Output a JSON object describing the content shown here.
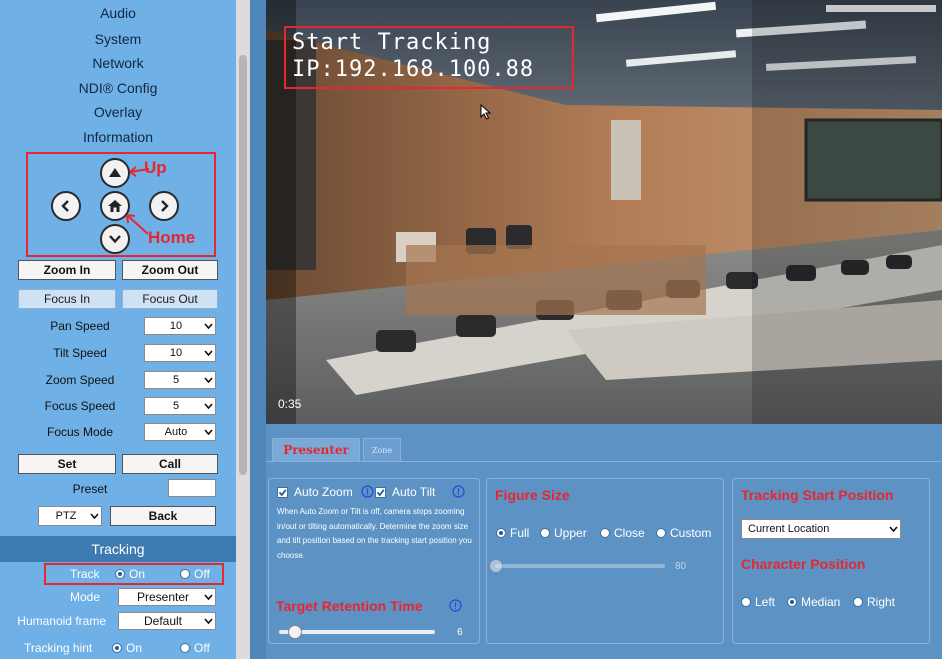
{
  "sidebar": {
    "nav": [
      "Audio",
      "System",
      "Network",
      "NDI® Config",
      "Overlay",
      "Information"
    ],
    "ptz_annotations": {
      "up": "Up",
      "home": "Home"
    },
    "zoom_in": "Zoom In",
    "zoom_out": "Zoom Out",
    "focus_in": "Focus In",
    "focus_out": "Focus Out",
    "speeds": [
      {
        "label": "Pan Speed",
        "value": "10"
      },
      {
        "label": "Tilt Speed",
        "value": "10"
      },
      {
        "label": "Zoom Speed",
        "value": "5"
      },
      {
        "label": "Focus Speed",
        "value": "5"
      },
      {
        "label": "Focus Mode",
        "value": "Auto"
      }
    ],
    "set": "Set",
    "call": "Call",
    "preset_label": "Preset",
    "preset_value": "",
    "mode_select": "PTZ",
    "back": "Back",
    "tracking_title": "Tracking",
    "track_label": "Track",
    "track_on": "On",
    "track_off": "Off",
    "mode_label": "Mode",
    "mode_value": "Presenter",
    "humanoid_label": "Humanoid frame",
    "humanoid_value": "Default",
    "hint_label": "Tracking hint",
    "hint_on": "On",
    "hint_off": "Off"
  },
  "video": {
    "osd_line1": "Start Tracking",
    "osd_line2": "IP:192.168.100.88",
    "timecode": "0:35"
  },
  "tabs": {
    "presenter": "Presenter",
    "zone": "Zone"
  },
  "panel": {
    "auto_zoom": "Auto Zoom",
    "auto_tilt": "Auto Tilt",
    "description": "When Auto Zoom or Tilt is off, camera stops zooming in/out or tilting automatically. Determine the zoom size and tilt position based on the tracking start position you choose.",
    "retention_title": "Target Retention Time",
    "retention_value": "6",
    "retention_fraction": 0.1,
    "figure_title": "Figure Size",
    "figure_options": [
      "Full",
      "Upper",
      "Close",
      "Custom"
    ],
    "figure_selected": "Full",
    "figure_value": "80",
    "start_title": "Tracking Start Position",
    "start_value": "Current Location",
    "char_title": "Character Position",
    "char_options": [
      "Left",
      "Median",
      "Right"
    ],
    "char_selected": "Median"
  },
  "colors": {
    "accent_red": "#e5272f",
    "sidebar_bg": "#6fb0e6",
    "panel_bg": "#5d93c4",
    "tracking_bar": "#3d7ab1"
  }
}
